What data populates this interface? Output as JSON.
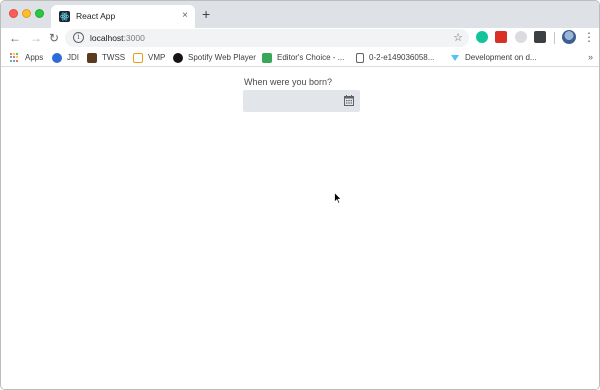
{
  "tab": {
    "title": "React App",
    "close_glyph": "×",
    "new_tab_glyph": "+"
  },
  "toolbar": {
    "back_glyph": "←",
    "forward_glyph": "→",
    "reload_glyph": "↻",
    "url_host": "localhost",
    "url_port": ":3000",
    "info_glyph": "i",
    "star_glyph": "☆",
    "menu_glyph": "⋮"
  },
  "bookmarks": [
    {
      "label": "Apps",
      "icon": "apps-grid-icon"
    },
    {
      "label": "JDI",
      "icon": "jdi-icon",
      "color": "#2d6bd6"
    },
    {
      "label": "TWSS",
      "icon": "twss-icon",
      "color": "#5b3a1e"
    },
    {
      "label": "VMP",
      "icon": "vmp-icon",
      "color": "#f29a1f"
    },
    {
      "label": "Spotify Web Player",
      "icon": "spotify-icon",
      "color": "#191414"
    },
    {
      "label": "Editor's Choice - ...",
      "icon": "editors-choice-icon",
      "color": "#3aa757"
    },
    {
      "label": "0-2-e149036058...",
      "icon": "document-icon",
      "color": "#ffffff"
    },
    {
      "label": "Development on d...",
      "icon": "dev-icon",
      "color": "#4fc3f7"
    }
  ],
  "bookmarks_overflow": "»",
  "page": {
    "question": "When were you born?",
    "date_value": ""
  },
  "colors": {
    "tabstrip": "#dee1e6",
    "input_bg": "#e2e6ea",
    "text": "#4a4a4a"
  }
}
